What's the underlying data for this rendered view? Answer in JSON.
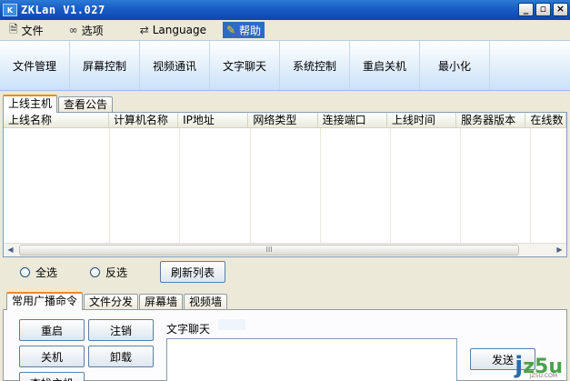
{
  "window": {
    "title": "ZKLan V1.027",
    "icon_text": "K"
  },
  "menu": [
    {
      "label": "文件",
      "icon": "document-icon"
    },
    {
      "label": "选项",
      "icon": "glasses-icon"
    },
    {
      "label": "Language",
      "icon": "language-icon"
    },
    {
      "label": "帮助",
      "icon": "help-icon"
    }
  ],
  "toolbar": [
    "文件管理",
    "屏幕控制",
    "视频通讯",
    "文字聊天",
    "系统控制",
    "重启关机",
    "最小化"
  ],
  "top_tabs": [
    "上线主机",
    "查看公告"
  ],
  "table": {
    "columns": [
      "上线名称",
      "计算机名称",
      "IP地址",
      "网络类型",
      "连接端口",
      "上线时间",
      "服务器版本",
      "在线数"
    ]
  },
  "scrollbar": {
    "grip": "III"
  },
  "selection": {
    "select_all": "全选",
    "invert": "反选",
    "refresh": "刷新列表"
  },
  "bottom_tabs": [
    "常用广播命令",
    "文件分发",
    "屏幕墙",
    "视频墙"
  ],
  "commands": [
    "重启",
    "注销",
    "关机",
    "卸载",
    "查找主机"
  ],
  "chat": {
    "label": "文字聊天",
    "send": "发送"
  },
  "watermark": {
    "main_j": "j",
    "main_rest": "z5u",
    "sub": "JZ5U.COM"
  }
}
